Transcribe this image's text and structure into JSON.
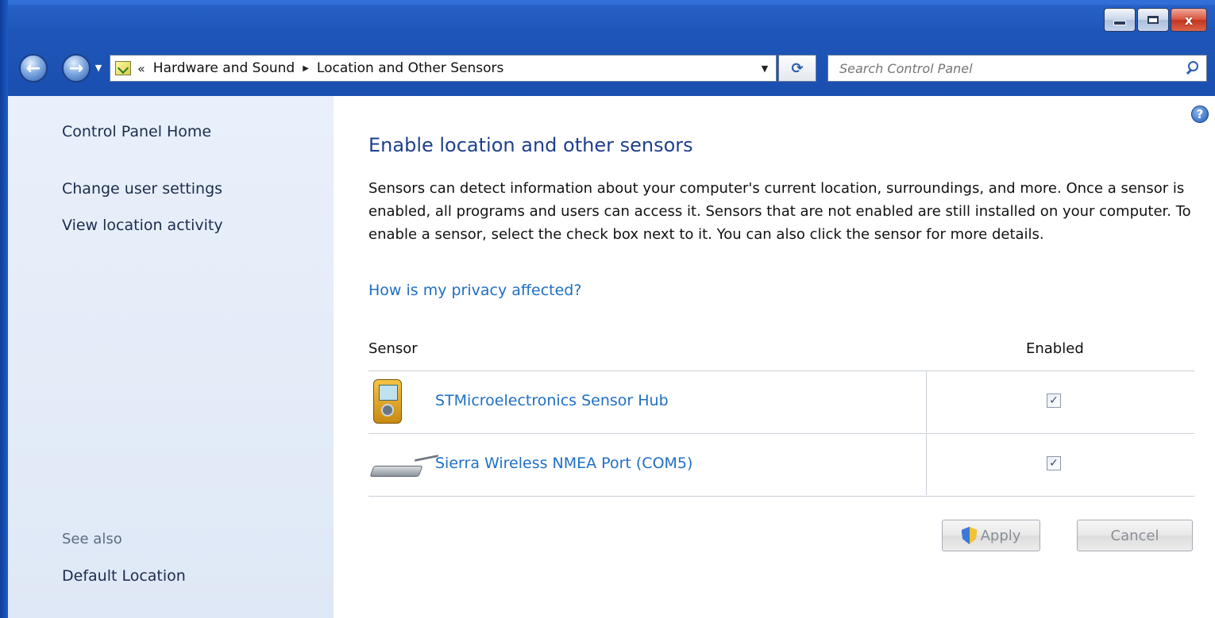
{
  "window": {
    "caption": {
      "minimize": "–",
      "maximize": "□",
      "close": "x"
    }
  },
  "nav": {
    "back": "←",
    "forward": "→",
    "recent_dropdown": "▼",
    "address": {
      "overflow": "«",
      "crumbs": [
        "Hardware and Sound",
        "Location and Other Sensors"
      ],
      "separator": "▶",
      "dropdown": "▼"
    },
    "refresh": "⟳",
    "search": {
      "placeholder": "Search Control Panel"
    }
  },
  "sidebar": {
    "home": "Control Panel Home",
    "links": [
      "Change user settings",
      "View location activity"
    ],
    "see_also_label": "See also",
    "see_also_links": [
      "Default Location"
    ]
  },
  "main": {
    "help": "?",
    "title": "Enable location and other sensors",
    "description": "Sensors can detect information about your computer's current location, surroundings, and more. Once a sensor is enabled, all programs and users can access it. Sensors that are not enabled are still installed on your computer. To enable a sensor, select the check box next to it. You can also click the sensor for more details.",
    "privacy_link": "How is my privacy affected?",
    "table": {
      "headers": {
        "sensor": "Sensor",
        "enabled": "Enabled"
      },
      "rows": [
        {
          "name": "STMicroelectronics Sensor Hub",
          "enabled": true,
          "check": "✓",
          "icon": "sensor-hub-icon"
        },
        {
          "name": "Sierra Wireless NMEA Port (COM5)",
          "enabled": true,
          "check": "✓",
          "icon": "serial-port-icon"
        }
      ]
    },
    "buttons": {
      "apply": "Apply",
      "cancel": "Cancel"
    }
  }
}
